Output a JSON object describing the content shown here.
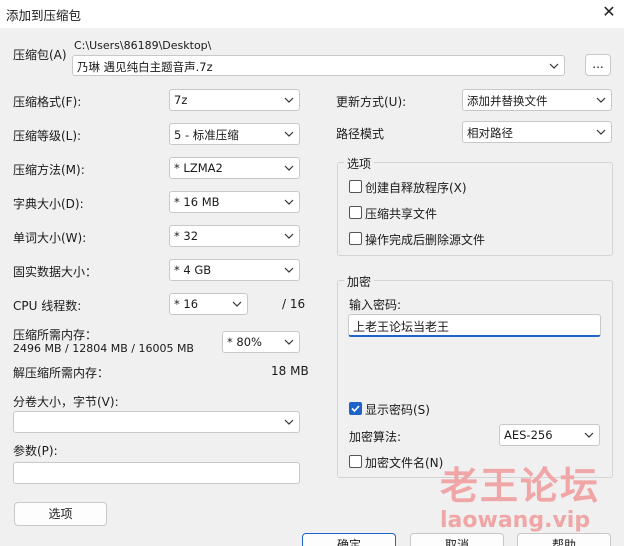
{
  "window": {
    "title": "添加到压缩包"
  },
  "archive": {
    "label": "压缩包(A)",
    "path": "C:\\Users\\86189\\Desktop\\",
    "filename": "乃琳 遇见纯白主题音声.7z",
    "browse_label": "..."
  },
  "left": {
    "format": {
      "label": "压缩格式(F):",
      "value": "7z"
    },
    "level": {
      "label": "压缩等级(L):",
      "value": "5 - 标准压缩"
    },
    "method": {
      "label": "压缩方法(M):",
      "value": "*  LZMA2"
    },
    "dict": {
      "label": "字典大小(D):",
      "value": "*  16 MB"
    },
    "word": {
      "label": "单词大小(W):",
      "value": "*  32"
    },
    "solid": {
      "label": "固实数据大小：",
      "value": "*  4 GB"
    },
    "threads": {
      "label": "CPU 线程数:",
      "value": "*  16",
      "max": "/ 16"
    },
    "mem_compress": {
      "label": "压缩所需内存：",
      "detail": "2496 MB / 12804 MB / 16005 MB",
      "percent": "* 80%"
    },
    "mem_decompress": {
      "label": "解压缩所需内存：",
      "value": "18 MB"
    },
    "split": {
      "label": "分卷大小，字节(V):",
      "value": ""
    },
    "params": {
      "label": "参数(P):",
      "value": ""
    },
    "options_button": "选项"
  },
  "right": {
    "update": {
      "label": "更新方式(U):",
      "value": "添加并替换文件"
    },
    "path_mode": {
      "label": "路径模式",
      "value": "相对路径"
    },
    "options": {
      "title": "选项",
      "sfx": {
        "label": "创建自释放程序(X)",
        "checked": false
      },
      "shared": {
        "label": "压缩共享文件",
        "checked": false
      },
      "delete": {
        "label": "操作完成后删除源文件",
        "checked": false
      }
    },
    "encryption": {
      "title": "加密",
      "password_label": "输入密码:",
      "password_value": "上老王论坛当老王",
      "show_password": {
        "label": "显示密码(S)",
        "checked": true
      },
      "method_label": "加密算法:",
      "method_value": "AES-256",
      "encrypt_names": {
        "label": "加密文件名(N)",
        "checked": false
      }
    }
  },
  "buttons": {
    "ok": "确定",
    "cancel": "取消",
    "help": "帮助"
  },
  "watermark": {
    "text1": "老王论坛",
    "text2": "laowang.vip"
  }
}
